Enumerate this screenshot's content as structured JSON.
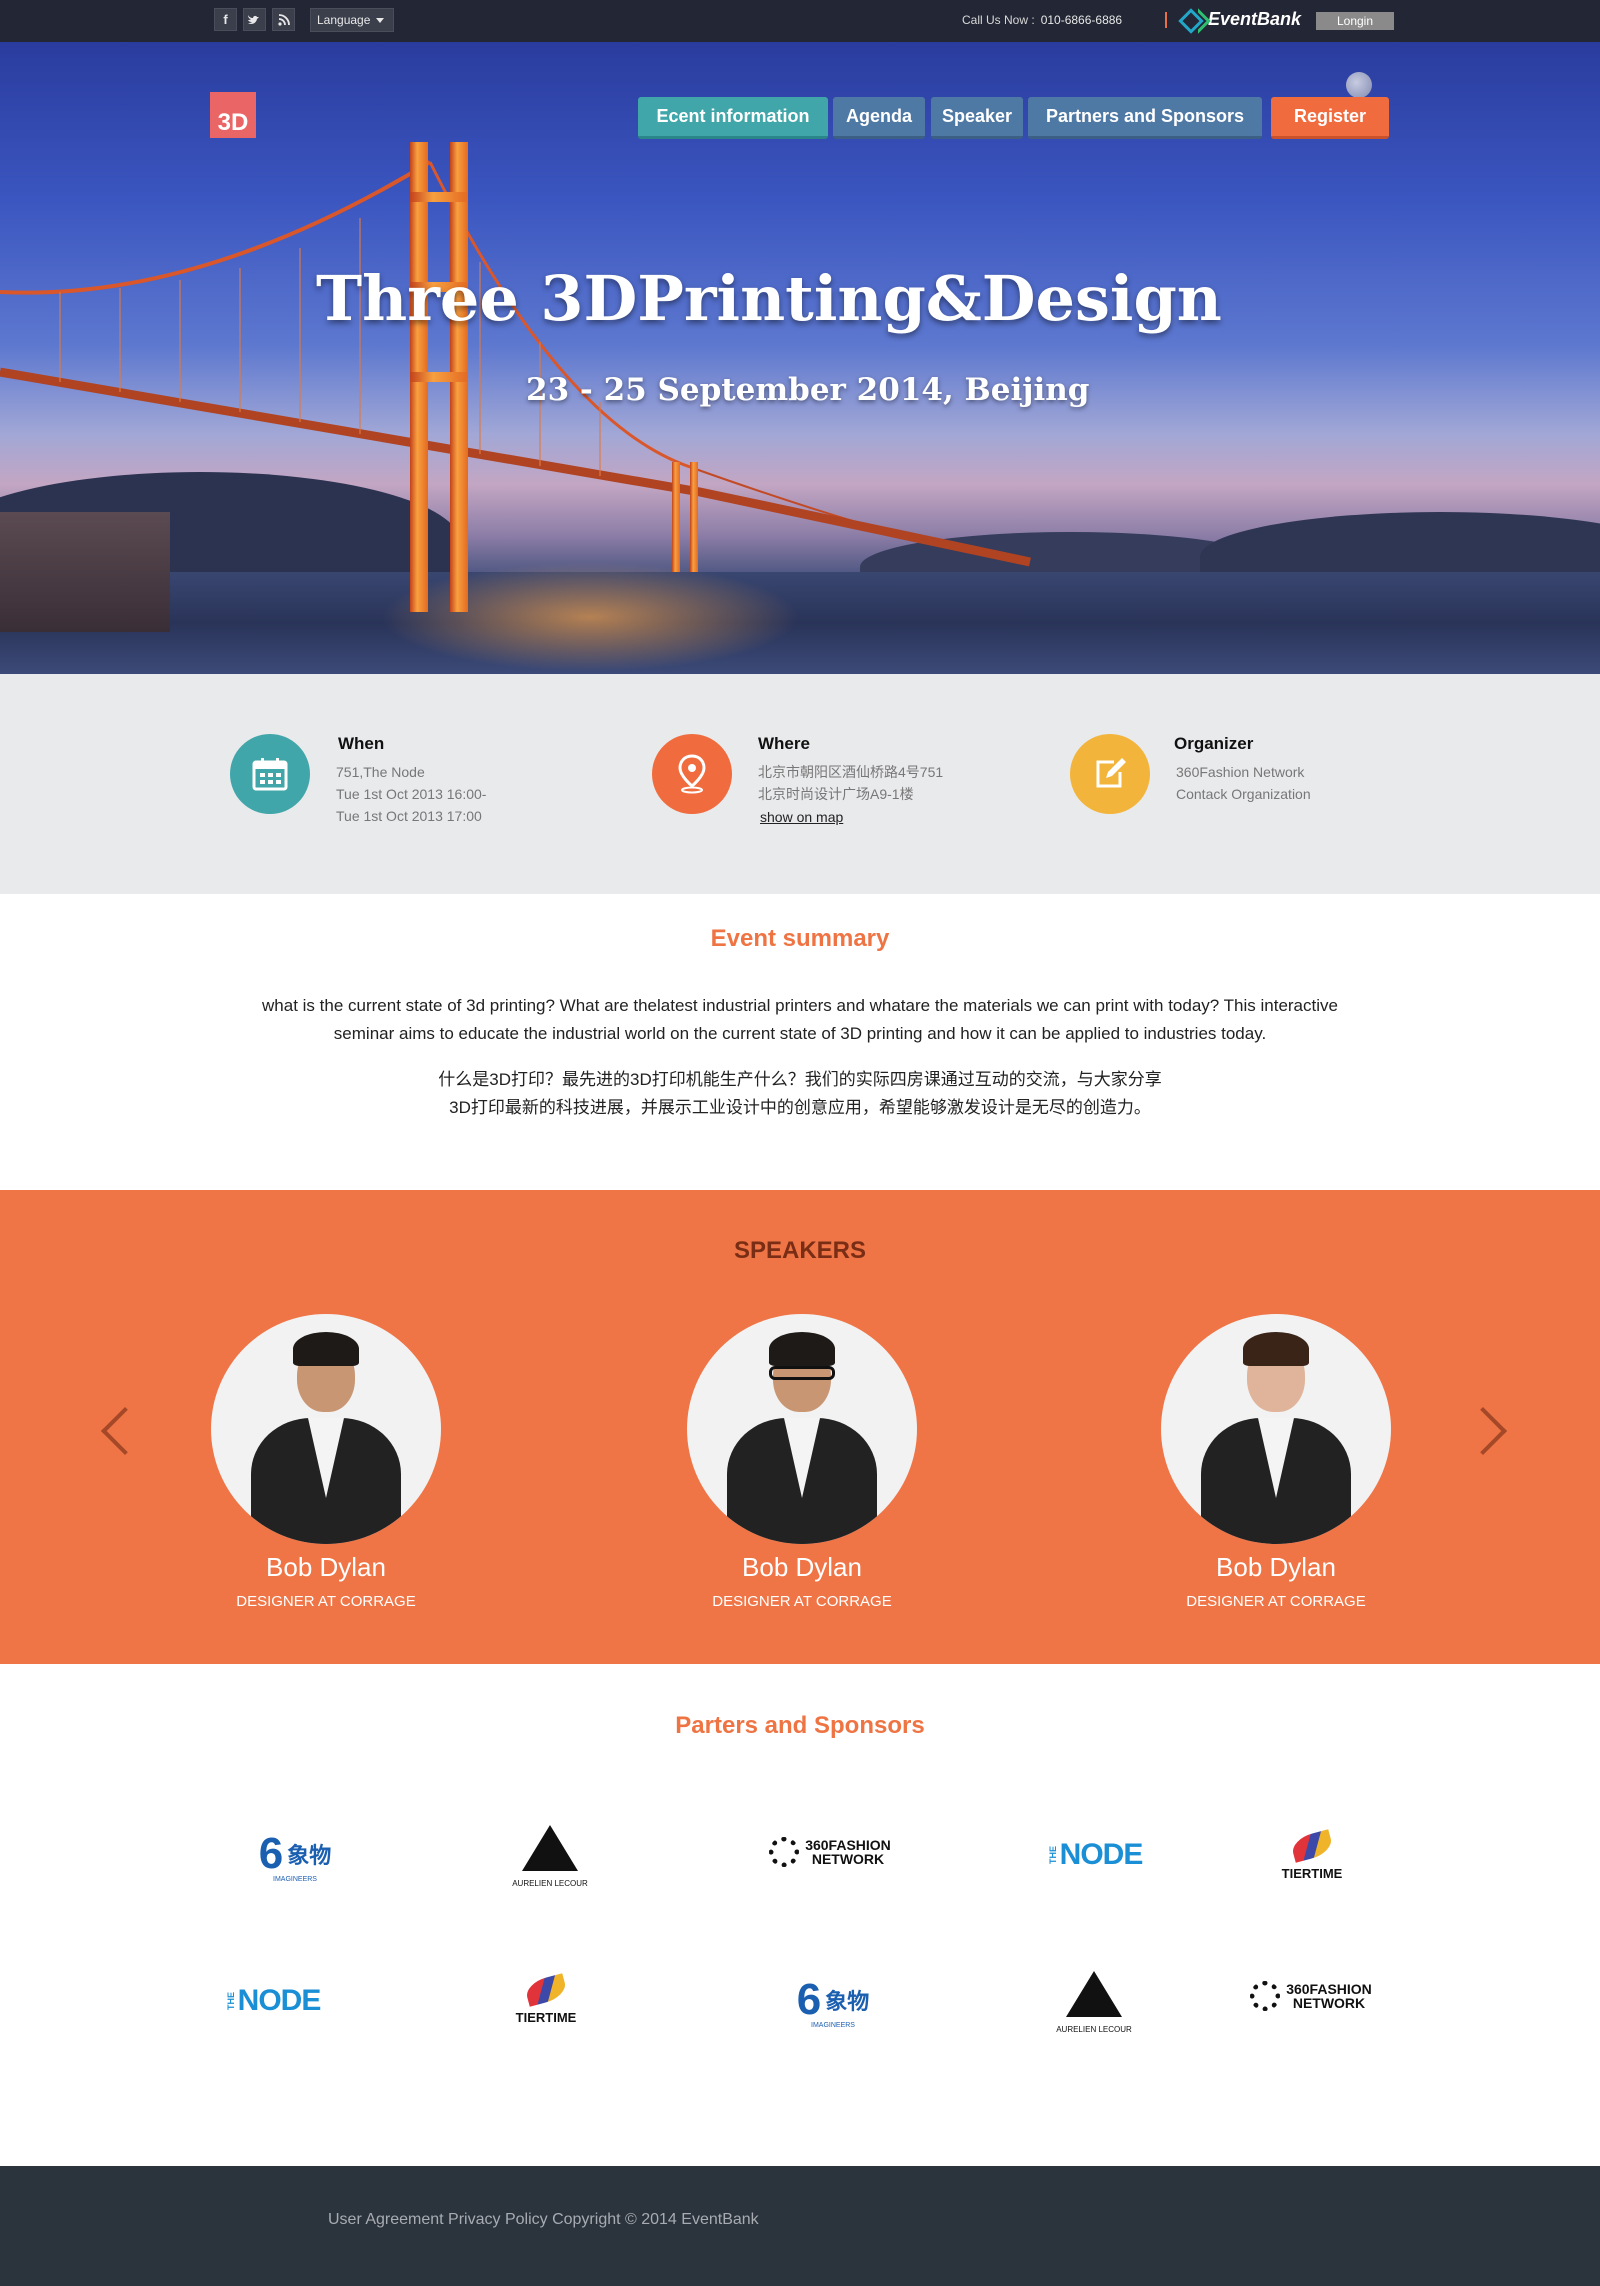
{
  "topbar": {
    "social_icons": [
      "facebook-icon",
      "twitter-icon",
      "rss-icon"
    ],
    "language_label": "Language",
    "call_label": "Call Us Now :",
    "call_number": "010-6866-6886",
    "brand": "EventBank",
    "login_label": "Longin"
  },
  "hero": {
    "logo_text": "3D",
    "nav": [
      "Ecent information",
      "Agenda",
      "Speaker",
      "Partners and Sponsors",
      "Register"
    ],
    "title": "Three 3DPrinting&Design",
    "subtitle": "23 - 25 September 2014, Beijing"
  },
  "info": {
    "when": {
      "title": "When",
      "line1": "751,The Node",
      "line2": "Tue 1st Oct 2013 16:00-",
      "line3": "Tue 1st Oct 2013 17:00"
    },
    "where": {
      "title": "Where",
      "line1": "北京市朝阳区酒仙桥路4号751",
      "line2": "北京时尚设计广场A9-1楼",
      "link": "show on map"
    },
    "organizer": {
      "title": "Organizer",
      "line1": "360Fashion Network",
      "line2": "Contack Organization"
    }
  },
  "summary": {
    "title": "Event summary",
    "en_line1": "what is the current state of 3d printing? What are thelatest industrial printers and whatare the materials we can print with today? This interactive",
    "en_line2": "seminar aims to educate the industrial world on the current state of 3D printing and how it can be applied to industries today.",
    "zh_line1": "什么是3D打印？最先进的3D打印机能生产什么？我们的实际四房课通过互动的交流，与大家分享",
    "zh_line2": "3D打印最新的科技进展，并展示工业设计中的创意应用，希望能够激发设计是无尽的创造力。"
  },
  "speakers": {
    "title": "SPEAKERS",
    "items": [
      {
        "name": "Bob Dylan",
        "role": "DESIGNER AT CORRAGE"
      },
      {
        "name": "Bob Dylan",
        "role": "DESIGNER AT CORRAGE"
      },
      {
        "name": "Bob Dylan",
        "role": "DESIGNER AT CORRAGE"
      }
    ]
  },
  "sponsors": {
    "title": "Parters and Sponsors",
    "logos": {
      "xiangwu": "象物",
      "xiangwu_sub": "IMAGINEERS",
      "aurelien": "AURELIEN LECOUR",
      "fashion_line1": "360FASHION",
      "fashion_line2": "NETWORK",
      "node_the": "THE",
      "node": "NODE",
      "tiertime": "TIERTIME"
    }
  },
  "footer": {
    "text": "User Agreement Privacy Policy Copyright © 2014 EventBank"
  },
  "colors": {
    "accent": "#ef7443",
    "teal": "#40a6a9",
    "orange": "#f06b3d",
    "yellow": "#f2b43b",
    "footer": "#2b333c"
  }
}
